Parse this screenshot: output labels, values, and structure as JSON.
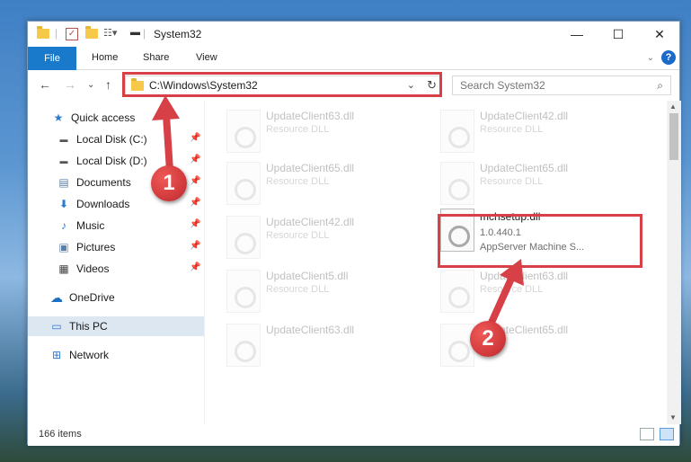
{
  "window": {
    "title": "System32",
    "controls": {
      "minimize": "—",
      "maximize": "☐",
      "close": "✕"
    }
  },
  "ribbon": {
    "file_label": "File",
    "tabs": [
      "Home",
      "Share",
      "View"
    ]
  },
  "address": {
    "path": "C:\\Windows\\System32"
  },
  "search": {
    "placeholder": "Search System32"
  },
  "sidebar": {
    "quick_access": "Quick access",
    "items": [
      {
        "label": "Local Disk (C:)",
        "icon": "drive-icon",
        "pinned": true
      },
      {
        "label": "Local Disk (D:)",
        "icon": "drive-icon",
        "pinned": true
      },
      {
        "label": "Documents",
        "icon": "documents-icon",
        "pinned": true
      },
      {
        "label": "Downloads",
        "icon": "downloads-icon",
        "pinned": true
      },
      {
        "label": "Music",
        "icon": "music-icon",
        "pinned": true
      },
      {
        "label": "Pictures",
        "icon": "pictures-icon",
        "pinned": true
      },
      {
        "label": "Videos",
        "icon": "videos-icon",
        "pinned": true
      }
    ],
    "onedrive": "OneDrive",
    "this_pc": "This PC",
    "network": "Network"
  },
  "files": [
    {
      "name": "UpdateClient63.dll",
      "desc": "Resource DLL"
    },
    {
      "name": "UpdateClient42.dll",
      "desc": "Resource DLL"
    },
    {
      "name": "UpdateClient65.dll",
      "desc": "Resource DLL"
    },
    {
      "name": "UpdateClient65.dll",
      "desc": "Resource DLL"
    },
    {
      "name": "UpdateClient42.dll",
      "desc": "Resource DLL"
    },
    {
      "name": "mchsetup.dll",
      "version": "1.0.440.1",
      "desc": "AppServer Machine S..."
    },
    {
      "name": "UpdateClient5.dll",
      "desc": "Resource DLL"
    },
    {
      "name": "UpdateClient63.dll",
      "desc": "Resource DLL"
    },
    {
      "name": "UpdateClient63.dll",
      "desc": ""
    },
    {
      "name": "UpdateClient65.dll",
      "desc": ""
    }
  ],
  "status": {
    "count": "166 items"
  },
  "annotations": {
    "step1": "1",
    "step2": "2",
    "color": "#d64046"
  }
}
